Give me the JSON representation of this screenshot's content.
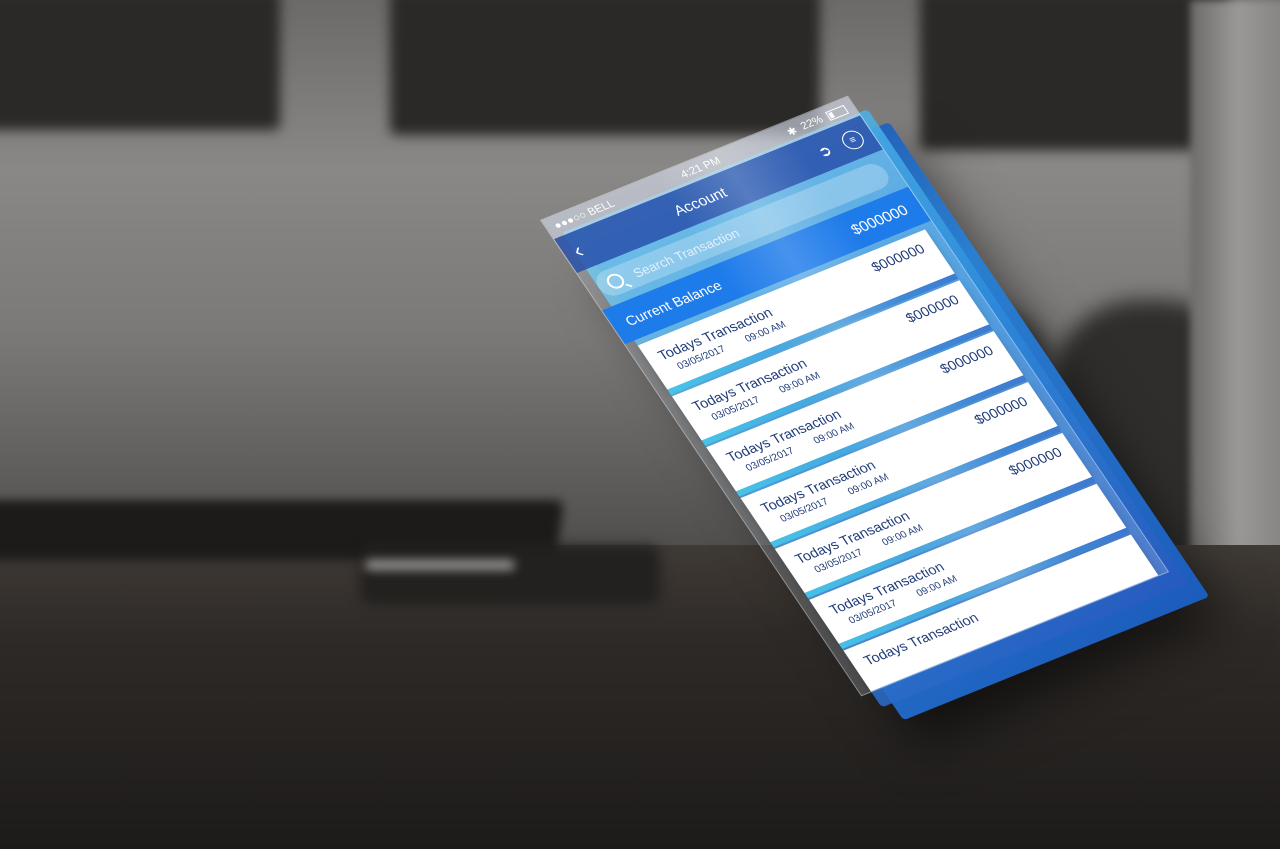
{
  "status_bar": {
    "carrier": "●●●○○ BELL",
    "time": "4:21 PM",
    "battery": "22%"
  },
  "nav": {
    "title": "Account"
  },
  "search": {
    "placeholder": "Search Transaction"
  },
  "balance": {
    "label": "Current Balance",
    "amount": "$000000"
  },
  "transactions": [
    {
      "title": "Todays Transaction",
      "date": "03/05/2017",
      "time": "09:00 AM",
      "amount": "$000000"
    },
    {
      "title": "Todays Transaction",
      "date": "03/05/2017",
      "time": "09:00 AM",
      "amount": "$000000"
    },
    {
      "title": "Todays Transaction",
      "date": "03/05/2017",
      "time": "09:00 AM",
      "amount": "$000000"
    },
    {
      "title": "Todays Transaction",
      "date": "03/05/2017",
      "time": "09:00 AM",
      "amount": "$000000"
    },
    {
      "title": "Todays Transaction",
      "date": "03/05/2017",
      "time": "09:00 AM",
      "amount": "$000000"
    },
    {
      "title": "Todays Transaction",
      "date": "03/05/2017",
      "time": "09:00 AM",
      "amount": ""
    },
    {
      "title": "Todays Transaction",
      "date": "",
      "time": "",
      "amount": ""
    }
  ],
  "colors": {
    "accent": "#1e7bea",
    "nav": "#2850aa",
    "text_dark": "#1e3a78"
  },
  "icons": {
    "back": "chevron-left-icon",
    "logout": "logout-icon",
    "menu": "menu-icon",
    "wifi": "wifi-icon",
    "bluetooth": "bluetooth-icon",
    "battery": "battery-icon",
    "search": "search-icon"
  }
}
